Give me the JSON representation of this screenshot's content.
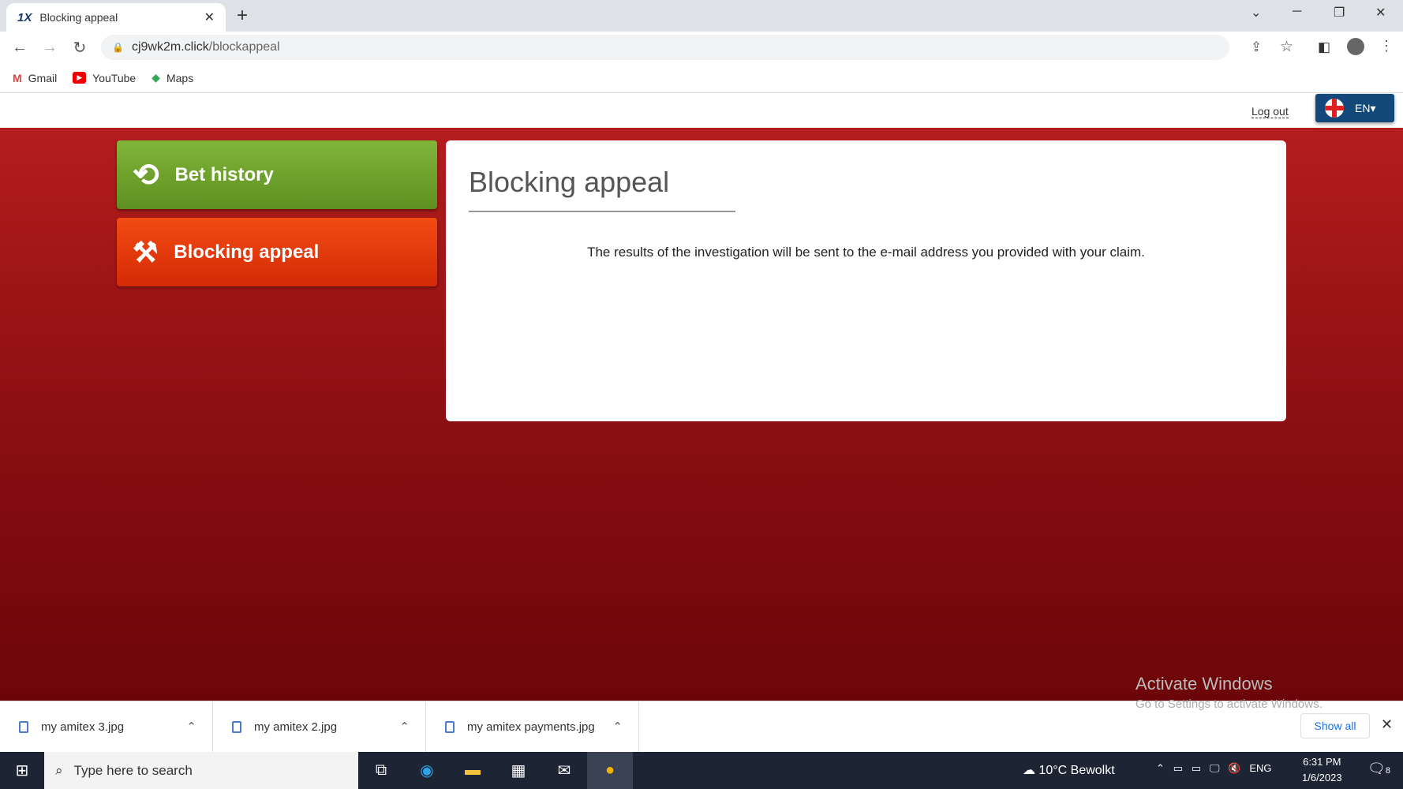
{
  "browser": {
    "tab_title": "Blocking appeal",
    "tab_logo": "1X",
    "url_domain": "cj9wk2m.click",
    "url_path": "/blockappeal",
    "bookmarks": [
      {
        "label": "Gmail",
        "icon": "gmail-icon"
      },
      {
        "label": "YouTube",
        "icon": "youtube-icon"
      },
      {
        "label": "Maps",
        "icon": "maps-icon"
      }
    ]
  },
  "header": {
    "logout": "Log out",
    "language": "EN▾"
  },
  "sidebar": {
    "items": [
      {
        "label": "Bet history",
        "icon": "history-icon",
        "color": "#6fa22c"
      },
      {
        "label": "Blocking appeal",
        "icon": "gavel-icon",
        "color": "#e83a0c"
      }
    ]
  },
  "content": {
    "title": "Blocking appeal",
    "message": "The results of the investigation will be sent to the e-mail address you provided with your claim."
  },
  "watermark": {
    "line1": "Activate Windows",
    "line2": "Go to Settings to activate Windows."
  },
  "downloads": {
    "items": [
      "my amitex 3.jpg",
      "my amitex 2.jpg",
      "my amitex payments.jpg"
    ],
    "show_all": "Show all"
  },
  "taskbar": {
    "search_placeholder": "Type here to search",
    "weather": "10°C  Bewolkt",
    "lang": "ENG",
    "time": "6:31 PM",
    "date": "1/6/2023",
    "notifications": "8"
  }
}
